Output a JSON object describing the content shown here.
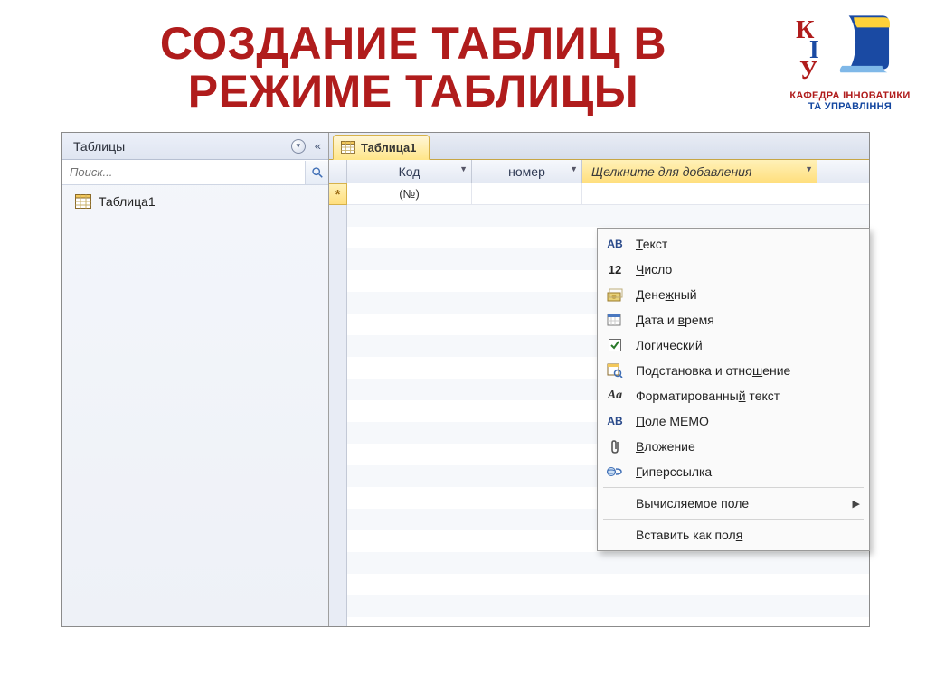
{
  "title": "СОЗДАНИЕ ТАБЛИЦ В РЕЖИМЕ ТАБЛИЦЫ",
  "logo": {
    "line1": "КАФЕДРА ІННОВАТИКИ",
    "line2": "ТА УПРАВЛІННЯ",
    "letters": [
      "К",
      "І",
      "У"
    ]
  },
  "nav": {
    "header": "Таблицы",
    "search_placeholder": "Поиск...",
    "items": [
      {
        "label": "Таблица1"
      }
    ]
  },
  "sheet": {
    "tab": "Таблица1",
    "columns": {
      "code": "Код",
      "number": "номер",
      "add": "Щелкните для добавления"
    },
    "new_row_code": "(№)",
    "new_row_marker": "*"
  },
  "menu": {
    "items": [
      {
        "icon": "AB",
        "icon_kind": "text",
        "label": "Текст",
        "ul": "Т"
      },
      {
        "icon": "12",
        "icon_kind": "num",
        "label": "Число",
        "ul": "Ч"
      },
      {
        "icon": "money",
        "icon_kind": "svg",
        "label": "Денежный",
        "ul": "ж"
      },
      {
        "icon": "date",
        "icon_kind": "svg",
        "label": "Дата и время",
        "ul": "в"
      },
      {
        "icon": "check",
        "icon_kind": "svg",
        "label": "Логический",
        "ul": "Л"
      },
      {
        "icon": "lookup",
        "icon_kind": "svg",
        "label": "Подстановка и отношение",
        "ul": "ш"
      },
      {
        "icon": "Aa",
        "icon_kind": "ital",
        "label": "Форматированный текст",
        "ul": "й"
      },
      {
        "icon": "AB",
        "icon_kind": "text",
        "label": "Поле МЕМО",
        "ul": "П"
      },
      {
        "icon": "clip",
        "icon_kind": "svg",
        "label": "Вложение",
        "ul": "В"
      },
      {
        "icon": "link",
        "icon_kind": "svg",
        "label": "Гиперссылка",
        "ul": "Г"
      }
    ],
    "calc": "Вычисляемое поле",
    "paste": "Вставить как поля"
  }
}
